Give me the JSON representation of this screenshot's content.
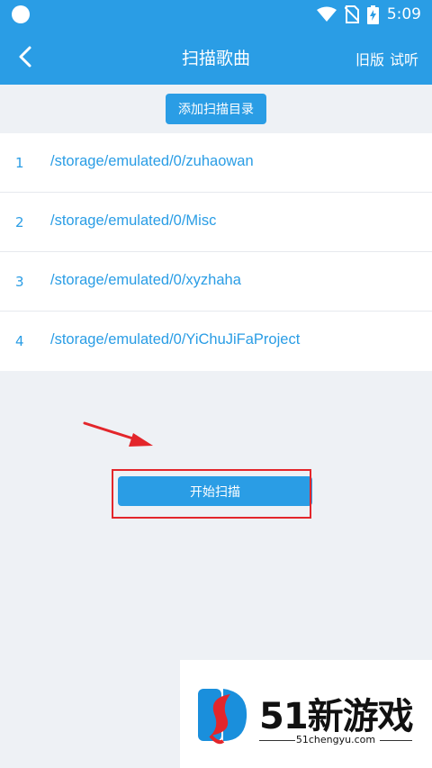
{
  "status_bar": {
    "time": "5:09",
    "accent": "#2a9de5"
  },
  "app_bar": {
    "title": "扫描歌曲",
    "old_version": "旧版",
    "try_listen": "试听"
  },
  "add_dir_button": "添加扫描目录",
  "directories": [
    {
      "index": "1",
      "path": "/storage/emulated/0/zuhaowan"
    },
    {
      "index": "2",
      "path": "/storage/emulated/0/Misc"
    },
    {
      "index": "3",
      "path": "/storage/emulated/0/xyzhaha"
    },
    {
      "index": "4",
      "path": "/storage/emulated/0/YiChuJiFaProject"
    }
  ],
  "start_scan_button": "开始扫描",
  "annotation_color": "#e3262b",
  "watermark": {
    "brand": "51新游戏",
    "url": "51chengyu.com"
  }
}
